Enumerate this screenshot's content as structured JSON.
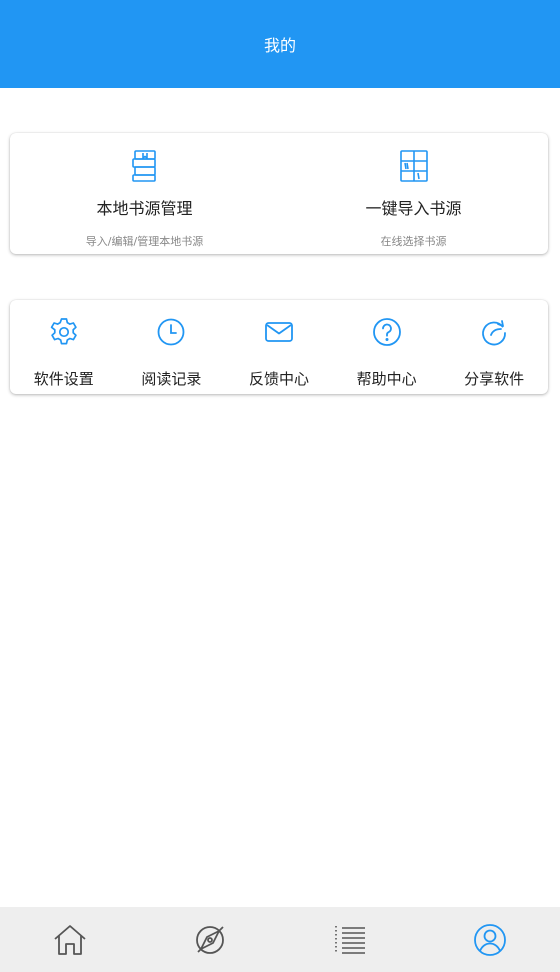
{
  "header": {
    "title": "我的"
  },
  "sources": [
    {
      "title": "本地书源管理",
      "subtitle": "导入/编辑/管理本地书源",
      "icon": "books-icon"
    },
    {
      "title": "一键导入书源",
      "subtitle": "在线选择书源",
      "icon": "bookshelf-icon"
    }
  ],
  "tools": [
    {
      "label": "软件设置",
      "icon": "gear-icon"
    },
    {
      "label": "阅读记录",
      "icon": "clock-icon"
    },
    {
      "label": "反馈中心",
      "icon": "mail-icon"
    },
    {
      "label": "帮助中心",
      "icon": "help-icon"
    },
    {
      "label": "分享软件",
      "icon": "share-icon"
    }
  ],
  "bottom_nav": [
    {
      "name": "home",
      "icon": "home-icon",
      "active": false
    },
    {
      "name": "discover",
      "icon": "compass-icon",
      "active": false
    },
    {
      "name": "list",
      "icon": "list-icon",
      "active": false
    },
    {
      "name": "profile",
      "icon": "user-icon",
      "active": true
    }
  ],
  "colors": {
    "primary": "#2196F3",
    "icon_inactive": "#555555",
    "nav_background": "#eeeeee"
  }
}
